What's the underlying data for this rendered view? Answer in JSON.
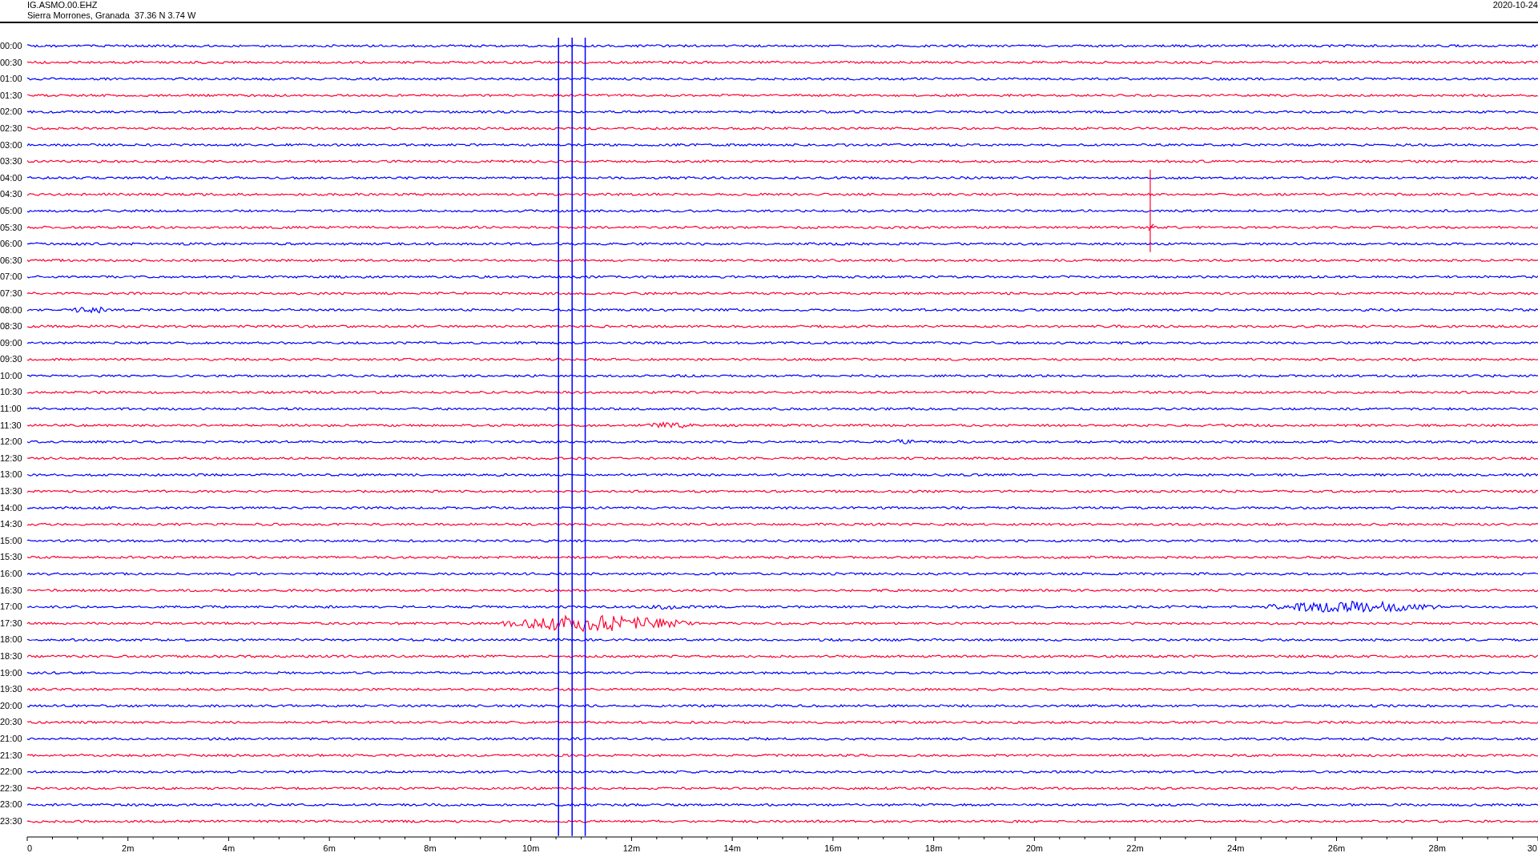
{
  "header": {
    "station": "IG.ASMO.00.EHZ",
    "location": "Sierra Morrones, Granada  37.36 N 3.74 W",
    "date": "2020-10-24"
  },
  "traces": [
    {
      "label": "00:00",
      "color": "#0000ff"
    },
    {
      "label": "00:30",
      "color": "#ff0033"
    },
    {
      "label": "01:00",
      "color": "#0000ff"
    },
    {
      "label": "01:30",
      "color": "#ff0033"
    },
    {
      "label": "02:00",
      "color": "#0000ff"
    },
    {
      "label": "02:30",
      "color": "#ff0033"
    },
    {
      "label": "03:00",
      "color": "#0000ff"
    },
    {
      "label": "03:30",
      "color": "#ff0033"
    },
    {
      "label": "04:00",
      "color": "#0000ff"
    },
    {
      "label": "04:30",
      "color": "#ff0033"
    },
    {
      "label": "05:00",
      "color": "#0000ff"
    },
    {
      "label": "05:30",
      "color": "#ff0033"
    },
    {
      "label": "06:00",
      "color": "#0000ff"
    },
    {
      "label": "06:30",
      "color": "#ff0033"
    },
    {
      "label": "07:00",
      "color": "#0000ff"
    },
    {
      "label": "07:30",
      "color": "#ff0033"
    },
    {
      "label": "08:00",
      "color": "#0000ff"
    },
    {
      "label": "08:30",
      "color": "#ff0033"
    },
    {
      "label": "09:00",
      "color": "#0000ff"
    },
    {
      "label": "09:30",
      "color": "#ff0033"
    },
    {
      "label": "10:00",
      "color": "#0000ff"
    },
    {
      "label": "10:30",
      "color": "#ff0033"
    },
    {
      "label": "11:00",
      "color": "#0000ff"
    },
    {
      "label": "11:30",
      "color": "#ff0033"
    },
    {
      "label": "12:00",
      "color": "#0000ff"
    },
    {
      "label": "12:30",
      "color": "#ff0033"
    },
    {
      "label": "13:00",
      "color": "#0000ff"
    },
    {
      "label": "13:30",
      "color": "#ff0033"
    },
    {
      "label": "14:00",
      "color": "#0000ff"
    },
    {
      "label": "14:30",
      "color": "#ff0033"
    },
    {
      "label": "15:00",
      "color": "#0000ff"
    },
    {
      "label": "15:30",
      "color": "#ff0033"
    },
    {
      "label": "16:00",
      "color": "#0000ff"
    },
    {
      "label": "16:30",
      "color": "#ff0033"
    },
    {
      "label": "17:00",
      "color": "#0000ff"
    },
    {
      "label": "17:30",
      "color": "#ff0033"
    },
    {
      "label": "18:00",
      "color": "#0000ff"
    },
    {
      "label": "18:30",
      "color": "#ff0033"
    },
    {
      "label": "19:00",
      "color": "#0000ff"
    },
    {
      "label": "19:30",
      "color": "#ff0033"
    },
    {
      "label": "20:00",
      "color": "#0000ff"
    },
    {
      "label": "20:30",
      "color": "#ff0033"
    },
    {
      "label": "21:00",
      "color": "#0000ff"
    },
    {
      "label": "21:30",
      "color": "#ff0033"
    },
    {
      "label": "22:00",
      "color": "#0000ff"
    },
    {
      "label": "22:30",
      "color": "#ff0033"
    },
    {
      "label": "23:00",
      "color": "#0000ff"
    },
    {
      "label": "23:30",
      "color": "#ff0033"
    }
  ],
  "axis_ticks": [
    "0",
    "2m",
    "4m",
    "6m",
    "8m",
    "10m",
    "12m",
    "14m",
    "16m",
    "18m",
    "20m",
    "22m",
    "24m",
    "26m",
    "28m",
    "30"
  ]
}
